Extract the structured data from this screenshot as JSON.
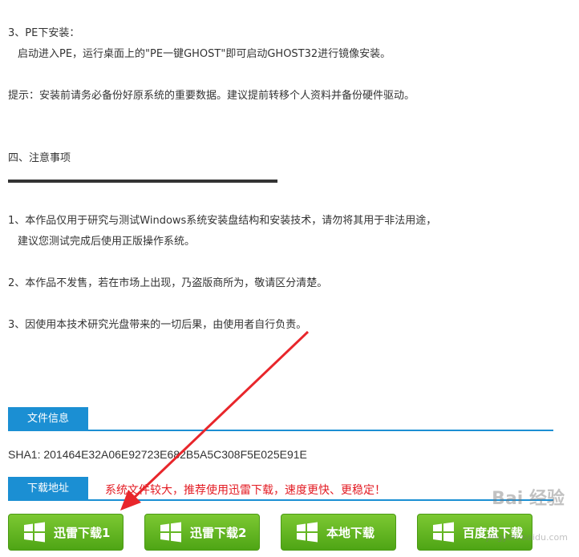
{
  "install": {
    "step3_title": "3、PE下安装：",
    "step3_text": "启动进入PE，运行桌面上的\"PE一键GHOST\"即可启动GHOST32进行镜像安装。",
    "tip": "提示：安装前请务必备份好原系统的重要数据。建议提前转移个人资料并备份硬件驱动。"
  },
  "notes": {
    "heading": "四、注意事项",
    "item1_line1": "1、本作品仅用于研究与测试Windows系统安装盘结构和安装技术，请勿将其用于非法用途，",
    "item1_line2": "建议您测试完成后使用正版操作系统。",
    "item2": "2、本作品不发售，若在市场上出现，乃盗版商所为，敬请区分清楚。",
    "item3": "3、因使用本技术研究光盘带来的一切后果，由使用者自行负责。"
  },
  "file_info": {
    "tab_label": "文件信息",
    "sha1": "SHA1: 201464E32A06E92723E682B5A5C308F5E025E91E"
  },
  "download": {
    "tab_label": "下载地址",
    "hint": "系统文件较大，推荐使用迅雷下载，速度更快、更稳定！",
    "buttons": [
      {
        "label": "迅雷下载1",
        "icon": "windows-icon"
      },
      {
        "label": "迅雷下载2",
        "icon": "windows-icon"
      },
      {
        "label": "本地下载",
        "icon": "windows-icon"
      },
      {
        "label": "百度盘下载",
        "icon": "windows-icon"
      }
    ]
  },
  "watermark": {
    "brand": "Bai 经验",
    "url": "jingyan.baidu.com"
  },
  "colors": {
    "accent": "#1b8fd3",
    "button_green": "#5cb820",
    "hint_red": "#e31b23",
    "arrow_red": "#e8262b"
  }
}
